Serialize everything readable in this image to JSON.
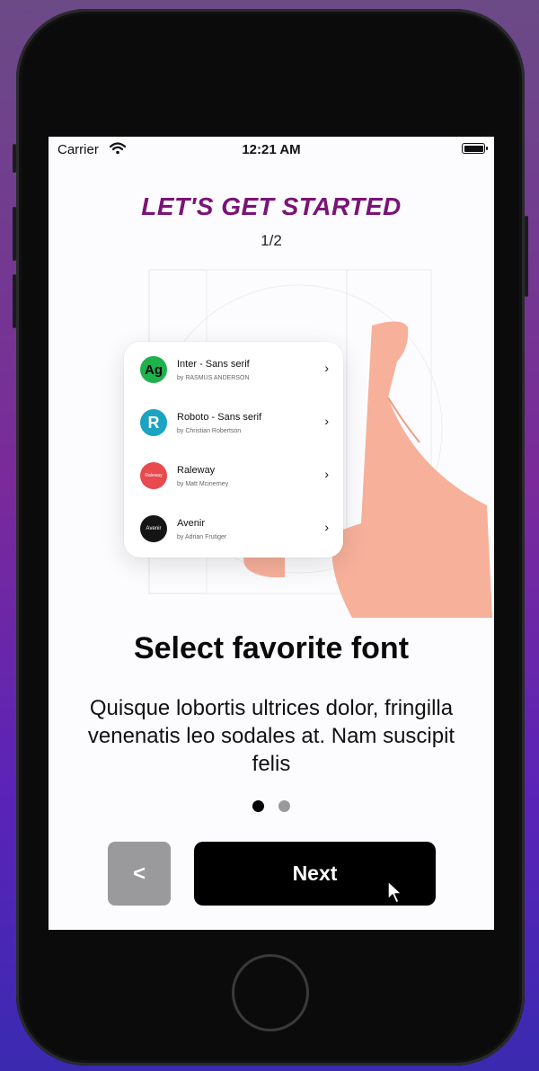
{
  "status": {
    "carrier": "Carrier",
    "time": "12:21 AM"
  },
  "header": {
    "headline": "LET'S GET STARTED",
    "step": "1/2"
  },
  "fonts": [
    {
      "name": "Inter - Sans serif",
      "author": "by RASMUS ANDERSON",
      "avatar_text": "Ag",
      "avatar_bg": "#1fb14b",
      "avatar_fg": "#0a0a0a"
    },
    {
      "name": "Roboto - Sans serif",
      "author": "by Christian Robertson",
      "avatar_text": "R",
      "avatar_bg": "#1aa3c3",
      "avatar_fg": "#ffffff"
    },
    {
      "name": "Raleway",
      "author": "by Matt Mcinerney",
      "avatar_text": "Raleway",
      "avatar_bg": "#e84a4d",
      "avatar_fg": "#ffffff"
    },
    {
      "name": "Avenir",
      "author": "by Adrian Frutiger",
      "avatar_text": "Avenir",
      "avatar_bg": "#151515",
      "avatar_fg": "#ffffff"
    }
  ],
  "main": {
    "title": "Select favorite font",
    "description": "Quisque lobortis ultrices dolor, fringilla venenatis leo sodales at. Nam suscipit felis"
  },
  "pager": {
    "active_index": 0,
    "total": 2,
    "active_color": "#000000",
    "inactive_color": "#999999"
  },
  "buttons": {
    "back_label": "<",
    "next_label": "Next"
  },
  "colors": {
    "headline": "#7a1477",
    "skin": "#f7b09a"
  }
}
